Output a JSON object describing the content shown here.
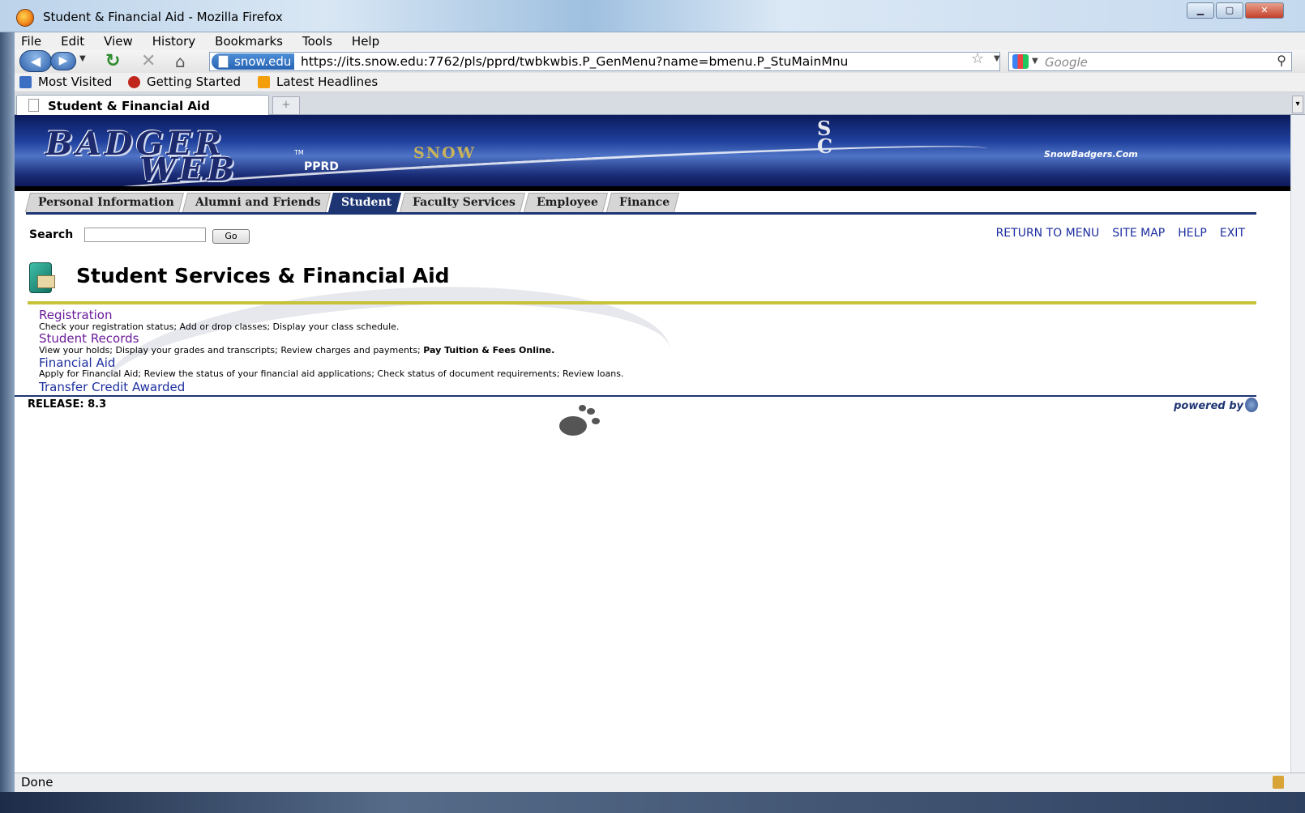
{
  "window": {
    "title": "Student & Financial Aid - Mozilla Firefox"
  },
  "menubar": {
    "items": [
      "File",
      "Edit",
      "View",
      "History",
      "Bookmarks",
      "Tools",
      "Help"
    ]
  },
  "navbar": {
    "site_identity": "snow.edu",
    "url": "https://its.snow.edu:7762/pls/pprd/twbkwbis.P_GenMenu?name=bmenu.P_StuMainMnu",
    "search_placeholder": "Google"
  },
  "bookmarks": {
    "items": [
      "Most Visited",
      "Getting Started",
      "Latest Headlines"
    ]
  },
  "tabs": {
    "active_label": "Student & Financial Aid",
    "new_tab_label": "+"
  },
  "banner": {
    "logo_line1": "BADGER",
    "logo_line2": "WEB",
    "trademark": "TM",
    "env": "PPRD",
    "snow_logo": "SNOW",
    "sc_logo_top": "S",
    "sc_logo_bottom": "C",
    "site_name": "SnowBadgers.Com"
  },
  "navtabs": [
    {
      "label": "Personal Information",
      "active": false
    },
    {
      "label": "Alumni and Friends",
      "active": false
    },
    {
      "label": "Student",
      "active": true
    },
    {
      "label": "Faculty Services",
      "active": false
    },
    {
      "label": "Employee",
      "active": false
    },
    {
      "label": "Finance",
      "active": false
    }
  ],
  "search": {
    "label": "Search",
    "value": "",
    "go_label": "Go"
  },
  "toplinks": [
    "RETURN TO MENU",
    "SITE MAP",
    "HELP",
    "EXIT"
  ],
  "page": {
    "title": "Student Services & Financial Aid"
  },
  "menu": {
    "registration": {
      "label": "Registration",
      "desc": "Check your registration status; Add or drop classes; Display your class schedule."
    },
    "student_records": {
      "label": "Student Records",
      "desc": "View your holds; Display your grades and transcripts; Review charges and payments;",
      "desc_bold": "Pay Tuition & Fees Online."
    },
    "financial_aid": {
      "label": "Financial Aid",
      "desc": "Apply for Financial Aid; Review the status of your financial aid applications; Check status of document requirements; Review loans."
    },
    "transfer_credit": {
      "label": "Transfer Credit Awarded"
    }
  },
  "footer": {
    "release": "RELEASE: 8.3",
    "powered_by": "powered by"
  },
  "statusbar": {
    "text": "Done"
  },
  "colors": {
    "banner": "#1f3f9c",
    "tab_active": "#1e3573",
    "link_visited": "#6a1b9a",
    "link": "#1c2e9e",
    "rule": "#c6c23a"
  }
}
